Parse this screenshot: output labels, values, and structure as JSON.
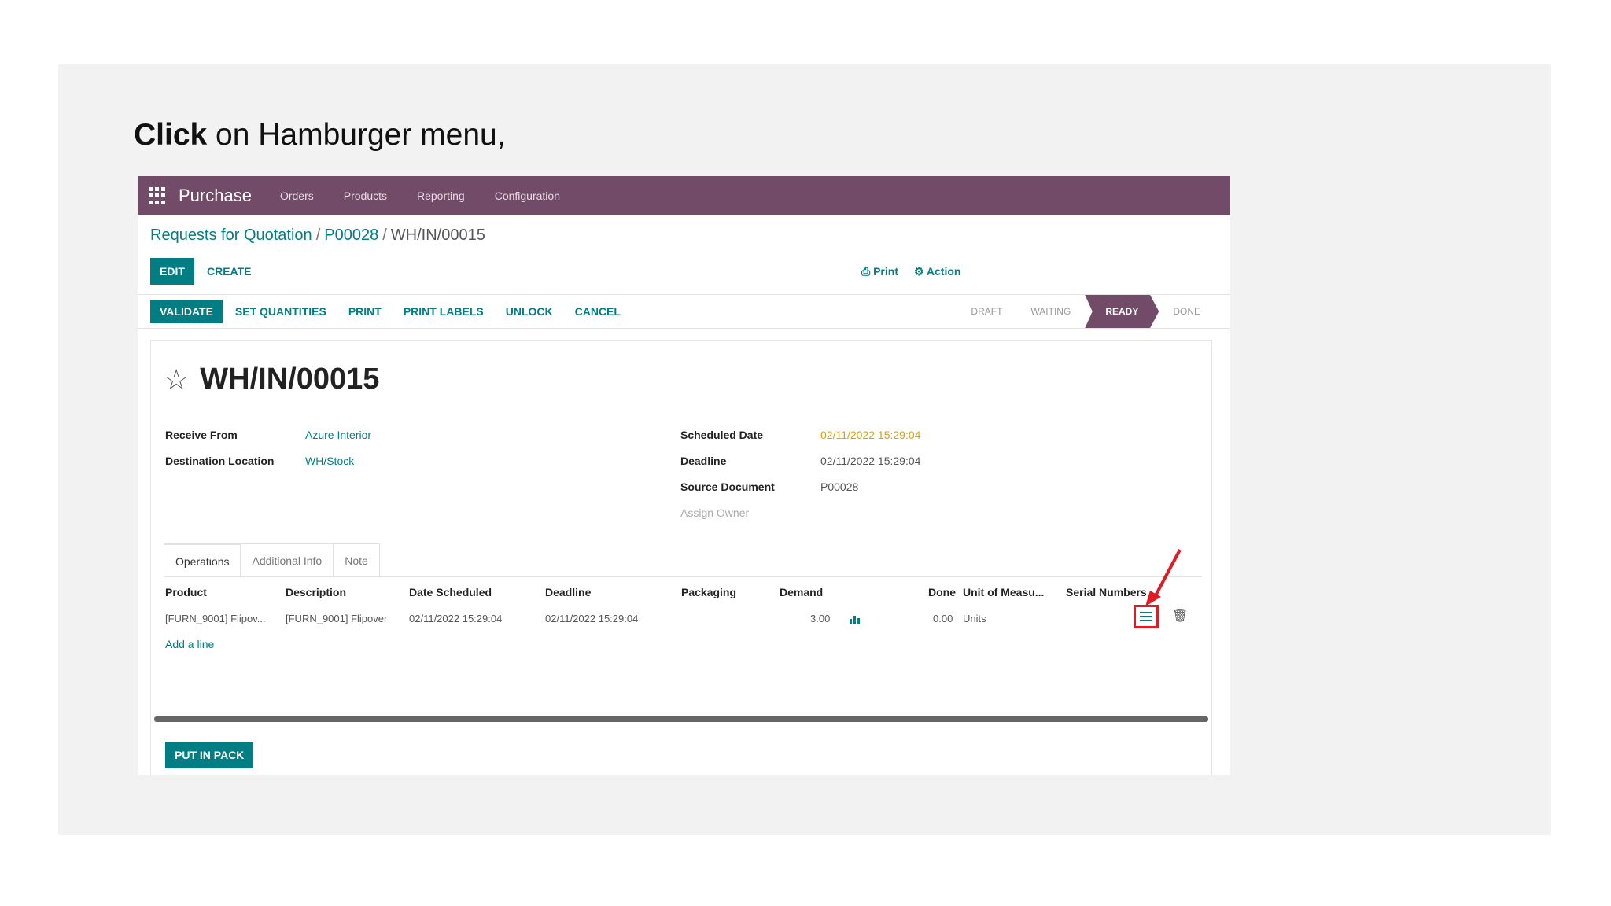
{
  "instruction": {
    "bold": "Click",
    "rest": " on Hamburger menu,"
  },
  "topnav": {
    "app_name": "Purchase",
    "items": [
      "Orders",
      "Products",
      "Reporting",
      "Configuration"
    ]
  },
  "breadcrumb": {
    "part1": "Requests for Quotation",
    "sep": "/",
    "part2": "P00028",
    "current": "WH/IN/00015"
  },
  "control": {
    "edit_label": "EDIT",
    "create_label": "CREATE",
    "print_label": "⎙ Print",
    "action_label": "⚙ Action"
  },
  "statusbar": {
    "buttons": [
      "VALIDATE",
      "SET QUANTITIES",
      "PRINT",
      "PRINT LABELS",
      "UNLOCK",
      "CANCEL"
    ],
    "stages": [
      "DRAFT",
      "WAITING",
      "READY",
      "DONE"
    ],
    "active_stage": "READY"
  },
  "record": {
    "name": "WH/IN/00015",
    "fields": {
      "receive_from_label": "Receive From",
      "receive_from_value": "Azure Interior",
      "destination_label": "Destination Location",
      "destination_value": "WH/Stock",
      "scheduled_label": "Scheduled Date",
      "scheduled_value": "02/11/2022 15:29:04",
      "deadline_label": "Deadline",
      "deadline_value": "02/11/2022 15:29:04",
      "source_label": "Source Document",
      "source_value": "P00028",
      "assign_owner": "Assign Owner"
    }
  },
  "tabs": [
    "Operations",
    "Additional Info",
    "Note"
  ],
  "table": {
    "columns": [
      "Product",
      "Description",
      "Date Scheduled",
      "Deadline",
      "Packaging",
      "Demand",
      "Done",
      "Unit of Measu...",
      "Serial Numbers"
    ],
    "row": {
      "product": "[FURN_9001] Flipov...",
      "description": "[FURN_9001] Flipover",
      "date_scheduled": "02/11/2022 15:29:04",
      "deadline": "02/11/2022 15:29:04",
      "demand": "3.00",
      "done": "0.00",
      "uom": "Units"
    },
    "add_line": "Add a line"
  },
  "put_in_pack": "PUT IN PACK",
  "colors": {
    "brand": "#714b67",
    "accent": "#017e84",
    "highlight": "#e01b24"
  }
}
